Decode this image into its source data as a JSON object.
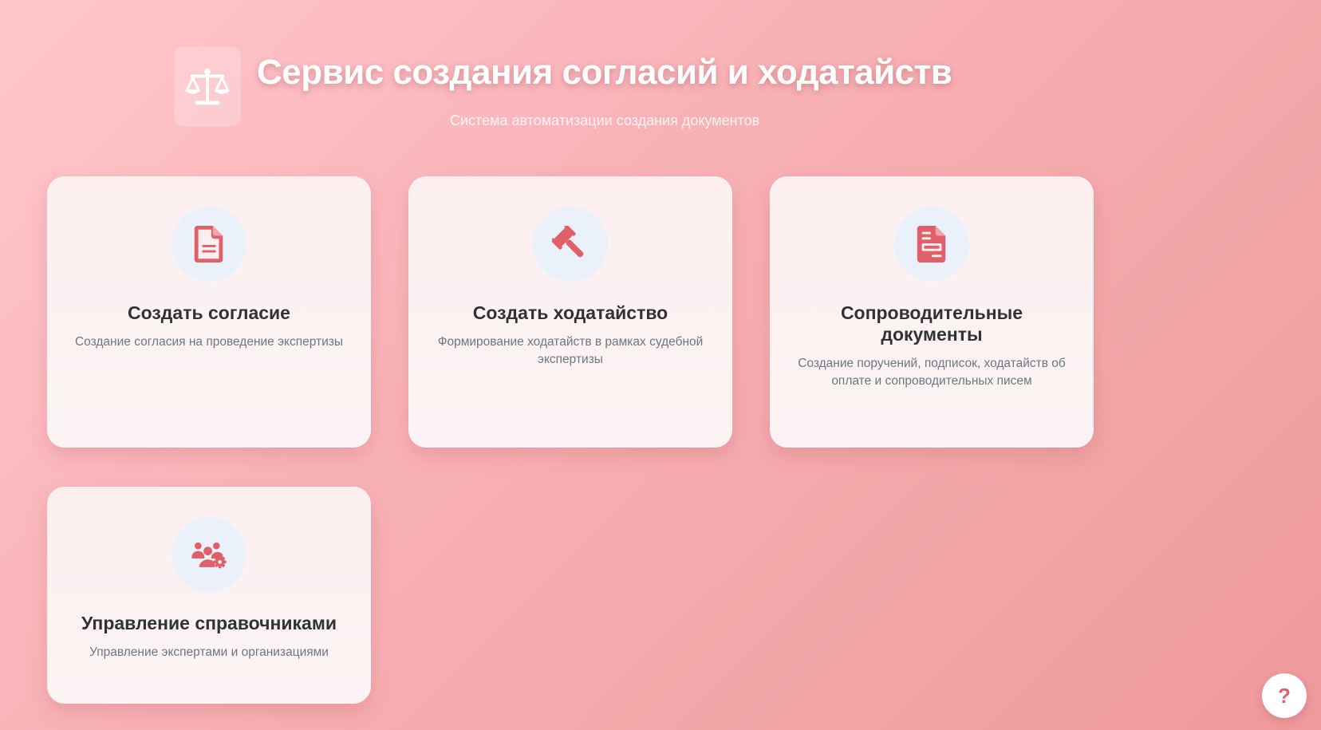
{
  "header": {
    "title": "Сервис создания согласий и ходатайств",
    "subtitle": "Система автоматизации создания документов",
    "logo_icon": "scales-icon"
  },
  "cards": [
    {
      "icon": "file-text-icon",
      "title": "Создать согласие",
      "description": "Создание согласия на проведение экспертизы"
    },
    {
      "icon": "gavel-icon",
      "title": "Создать ходатайство",
      "description": "Формирование ходатайств в рамках судебной экспертизы"
    },
    {
      "icon": "file-invoice-icon",
      "title": "Сопроводительные документы",
      "description": "Создание поручений, подписок, ходатайств об оплате и сопроводительных писем"
    },
    {
      "icon": "users-cog-icon",
      "title": "Управление справочниками",
      "description": "Управление экспертами и организациями"
    }
  ],
  "help": {
    "label": "?"
  },
  "colors": {
    "accent": "#e0606a",
    "icon_circle_bg": "#eaf1fb",
    "title_text": "#2f3338",
    "description_text": "#6c7685"
  }
}
